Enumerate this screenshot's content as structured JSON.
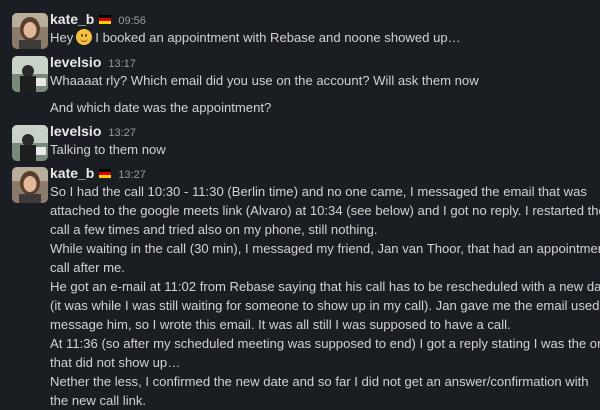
{
  "flag_colors": {
    "black": "#000000",
    "red": "#dd0000",
    "gold": "#ffce00"
  },
  "messages": [
    {
      "author": "kate_b",
      "flag_icon": "germany-flag",
      "time": "09:56",
      "lines": [
        {
          "before_emoji": "Hey",
          "emoji": "slightly-smiling-face",
          "after_emoji": "I booked an appointment with Rebase and noone showed up…"
        }
      ]
    },
    {
      "author": "levelsio",
      "time": "13:17",
      "lines": [
        "Whaaaat rly? Which email did you use on the account? Will ask them now"
      ],
      "followup": "And which date was the appointment?"
    },
    {
      "author": "levelsio",
      "time": "13:27",
      "lines": [
        "Talking to them now"
      ]
    },
    {
      "author": "kate_b",
      "flag_icon": "germany-flag",
      "time": "13:27",
      "lines": [
        "So I had the call 10:30 - 11:30 (Berlin time) and no one came, I messaged the email that was",
        "attached to the google meets link (Alvaro) at 10:34 (see below) and I got no reply. I restarted the",
        "call a few times and tried also on my phone, still nothing.",
        "While waiting in the call (30 min), I messaged my friend, Jan van Thoor, that had an appointment",
        "call after me.",
        "He got an e-mail at 11:02 from Rebase saying that his call has to be rescheduled with a new date",
        "(it was while I was still waiting for someone to show up in my call). Jan gave me the email used to",
        "message him, so I wrote this email. It was all still I was supposed to have a call.",
        "At 11:36 (so after my scheduled meeting was supposed to end) I got a reply stating I was the one",
        "that did not show up…",
        "Nether the less, I confirmed the new date and so far I did not get an answer/confirmation with",
        "the new call link."
      ]
    }
  ]
}
